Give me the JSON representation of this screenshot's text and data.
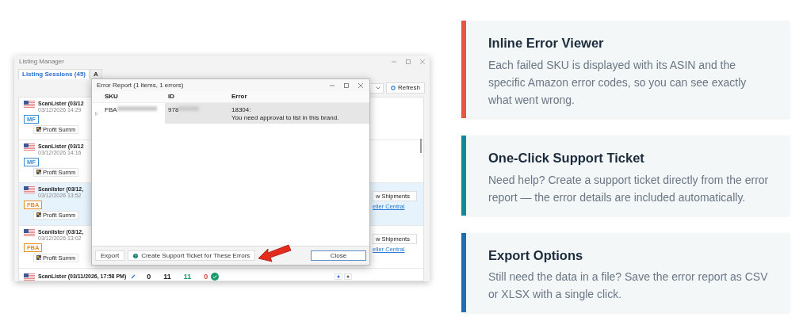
{
  "screenshot": {
    "window": {
      "title": "Listing Manager"
    },
    "tabs": [
      {
        "label": "Listing Sessions (45)",
        "selected": true
      },
      {
        "label": "A",
        "selected": false
      }
    ],
    "refresh_button": "Refresh",
    "sessions": [
      {
        "title": "ScanLister (03/12",
        "date": "03/12/2026 14:29",
        "badge": "MF",
        "color": "#3b8fd9",
        "summary_button": "Profit Summ",
        "selected": false
      },
      {
        "title": "ScanLister (03/12",
        "date": "03/12/2026 14:16",
        "badge": "MF",
        "color": "#3b8fd9",
        "summary_button": "Profit Summ",
        "selected": false
      },
      {
        "title": "Scanlister (03/12,",
        "date": "03/12/2026 13:52",
        "badge": "FBA",
        "color": "#e8902c",
        "summary_button": "Profit Summ",
        "shipments_button": "w Shipments",
        "link": "eller Central",
        "selected": true
      },
      {
        "title": "Scanlister (03/12,",
        "date": "03/12/2026 13:02",
        "badge": "FBA",
        "color": "#e8902c",
        "summary_button": "Profit Summ",
        "shipments_button": "w Shipments",
        "link": "eller Central",
        "selected": false
      }
    ],
    "last_session": {
      "title": "ScanLister (03/11/2026, 17:58 PM)",
      "counts": [
        {
          "value": "0",
          "color": "#222222"
        },
        {
          "value": "11",
          "color": "#222222"
        },
        {
          "value": "11",
          "color": "#1a9a6a"
        },
        {
          "value": "0",
          "color": "#e04a3a"
        }
      ]
    },
    "dialog": {
      "title": "Error Report (1 items, 1 errors)",
      "columns": [
        "SKU",
        "ID",
        "Error"
      ],
      "rows": [
        {
          "sku": "FBA",
          "id": "978",
          "error_code": "18304:",
          "error_message": "You need approval to list in this brand."
        }
      ],
      "export_button": "Export",
      "support_button": "Create Support Ticket for These Errors",
      "close_button": "Close"
    }
  },
  "features": [
    {
      "title": "Inline Error Viewer",
      "text": "Each failed SKU is displayed with its ASIN and the specific Amazon error codes, so you can see exactly what went wrong.",
      "color": "#e8553f"
    },
    {
      "title": "One-Click Support Ticket",
      "text": "Need help? Create a support ticket directly from the error report — the error details are included automatically.",
      "color": "#0e8a9a"
    },
    {
      "title": "Export Options",
      "text": "Still need the data in a file? Save the error report as CSV or XLSX with a single click.",
      "color": "#1f6fb0"
    }
  ]
}
